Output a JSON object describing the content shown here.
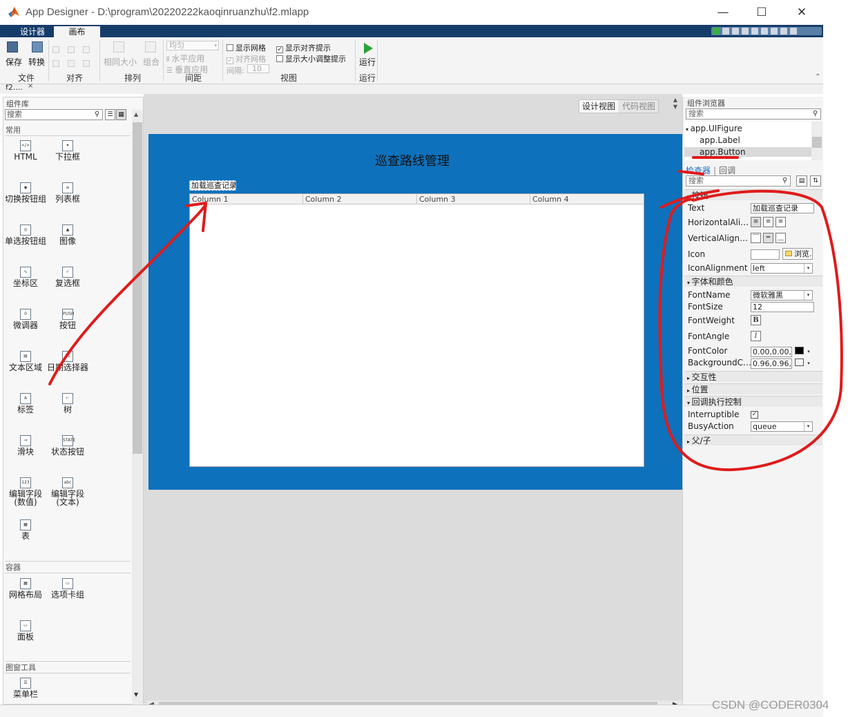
{
  "window": {
    "title": "App Designer - D:\\program\\20220222kaoqinruanzhu\\f2.mlapp",
    "minimize": "—",
    "maximize": "☐",
    "close": "✕"
  },
  "ribbon": {
    "tabs": [
      "设计器",
      "画布"
    ],
    "file_group": {
      "save": "保存",
      "convert": "转换",
      "label": "文件"
    },
    "align_group": {
      "label": "对齐"
    },
    "arrange_group": {
      "same_size": "相同大小",
      "group": "组合",
      "label": "排列"
    },
    "space_group": {
      "dropdown": "均匀",
      "horizontal": "水平应用",
      "vertical": "垂直应用",
      "label": "间距"
    },
    "view_group": {
      "show_grid": "显示网格",
      "snap_grid": "对齐网格",
      "interval_label": "间隔:",
      "interval_value": "10",
      "show_align_hints": "显示对齐提示",
      "show_resize_hints": "显示大小调整提示",
      "label": "视图"
    },
    "run_group": {
      "run": "运行",
      "label": "运行"
    }
  },
  "file_tab": {
    "name": "f2....",
    "close": "×"
  },
  "component_library": {
    "title": "组件库",
    "search_placeholder": "搜索",
    "sections": {
      "common": "常用",
      "containers": "容器",
      "figure_tools": "图窗工具"
    },
    "common_items": [
      {
        "label": "HTML",
        "icon": "</>"
      },
      {
        "label": "下拉框",
        "icon": "▾"
      },
      {
        "label": "切换按钮组",
        "icon": "◉"
      },
      {
        "label": "列表框",
        "icon": "≡"
      },
      {
        "label": "单选按钮组",
        "icon": "◎"
      },
      {
        "label": "图像",
        "icon": "▲"
      },
      {
        "label": "坐标区",
        "icon": "∿"
      },
      {
        "label": "复选框",
        "icon": "✓"
      },
      {
        "label": "微调器",
        "icon": "0"
      },
      {
        "label": "按钮",
        "icon": "PUSH"
      },
      {
        "label": "文本区域",
        "icon": "▤"
      },
      {
        "label": "日期选择器",
        "icon": "31"
      },
      {
        "label": "标签",
        "icon": "A"
      },
      {
        "label": "树",
        "icon": "⊢"
      },
      {
        "label": "滑块",
        "icon": "⊸"
      },
      {
        "label": "状态按钮",
        "icon": "STATE"
      },
      {
        "label": "编辑字段(数值)",
        "icon": "123"
      },
      {
        "label": "编辑字段(文本)",
        "icon": "abc"
      },
      {
        "label": "表",
        "icon": "▦"
      }
    ],
    "container_items": [
      {
        "label": "网格布局",
        "icon": "▦"
      },
      {
        "label": "选项卡组",
        "icon": "▭"
      },
      {
        "label": "面板",
        "icon": "▭"
      }
    ],
    "figure_tool_items": [
      {
        "label": "菜单栏",
        "icon": "☰"
      }
    ]
  },
  "canvas": {
    "view_design": "设计视图",
    "view_code": "代码视图",
    "figure_title": "巡查路线管理",
    "button_text": "加载巡查记录",
    "table_columns": [
      "Column 1",
      "Column 2",
      "Column 3",
      "Column 4"
    ]
  },
  "component_browser": {
    "title": "组件浏览器",
    "search_placeholder": "搜索",
    "tree": [
      "app.UIFigure",
      "app.Label",
      "app.Button"
    ],
    "selected_index": 2
  },
  "inspector": {
    "tabs": [
      "检查器",
      "回调"
    ],
    "search_placeholder": "搜索",
    "sections": {
      "button": "按钮",
      "font_color": "字体和颜色",
      "interactivity": "交互性",
      "position": "位置",
      "callback_control": "回调执行控制",
      "parent_child": "父/子"
    },
    "props": {
      "text_name": "Text",
      "text_value": "加载巡查记录",
      "halign_name": "HorizontalAlig...",
      "valign_name": "VerticalAlignm...",
      "icon_name": "Icon",
      "icon_value": "",
      "browse": "浏览...",
      "iconalign_name": "IconAlignment",
      "iconalign_value": "left",
      "fontname_name": "FontName",
      "fontname_value": "微软雅黑",
      "fontsize_name": "FontSize",
      "fontsize_value": "12",
      "fontweight_name": "FontWeight",
      "fontweight_value": "B",
      "fontangle_name": "FontAngle",
      "fontangle_value": "I",
      "fontcolor_name": "FontColor",
      "fontcolor_value": "0.00,0.00,0.00",
      "bgcolor_name": "BackgroundCo...",
      "bgcolor_value": "0.96,0.96,0.96",
      "interruptible_name": "Interruptible",
      "interruptible_value": "✓",
      "busyaction_name": "BusyAction",
      "busyaction_value": "queue"
    }
  },
  "watermark": "CSDN @CODER0304",
  "colors": {
    "figure_bg": "#0e71bc",
    "ribbon_tabstrip": "#163c6a",
    "annotation_red": "#e01b1b",
    "inspector_tab_active": "#1f6fc6"
  }
}
